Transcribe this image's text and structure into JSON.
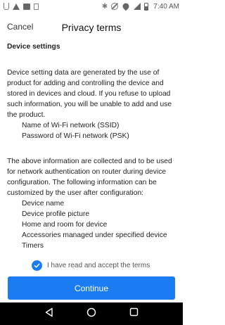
{
  "status_bar": {
    "time": "7:40 AM",
    "left_icons": [
      "usb-icon",
      "warning-icon",
      "image-icon",
      "small-box-icon"
    ],
    "right_icons": [
      "bluetooth-icon",
      "mute-icon",
      "wifi-icon",
      "signal-icon",
      "battery-icon"
    ]
  },
  "header": {
    "cancel_label": "Cancel",
    "title": "Privacy terms"
  },
  "content": {
    "section_title": "Device settings",
    "paragraph_1": "Device setting data are generated by the use of product for adding and controlling the device and stored in devices and cloud. If you refuse to upload such information, you will be unable to add and use the product.",
    "list_1": [
      "Name of Wi-Fi network (SSID)",
      "Password of Wi-Fi network (PSK)"
    ],
    "paragraph_2": "The above information are collected and to be used for network authentication on router during device configuration. The following information can be customized by the user after configuration:",
    "list_2": [
      "Device name",
      "Device profile picture",
      "Home and room for device",
      "Accessories managed under specified device",
      "Timers"
    ]
  },
  "footer": {
    "accept_label": "I have read and accept the terms",
    "accept_checked": true,
    "continue_label": "Continue",
    "accent_color": "#1a7cf0"
  },
  "nav_bar": {
    "buttons": [
      "back-icon",
      "home-icon",
      "recents-icon"
    ]
  }
}
